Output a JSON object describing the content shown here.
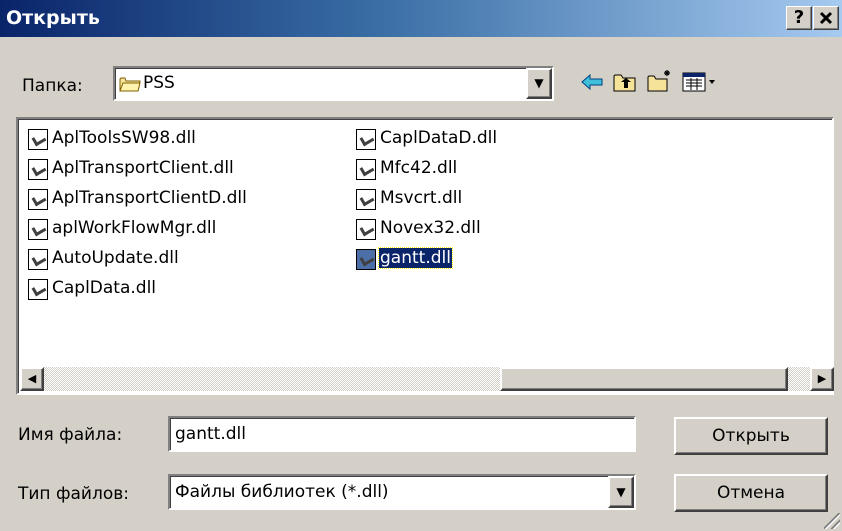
{
  "window": {
    "title": "Открыть",
    "help_label": "?",
    "close_label": "✕"
  },
  "lookin": {
    "label": "Папка:",
    "value": "PSS"
  },
  "files": [
    {
      "name": "AplToolsSW98.dll",
      "selected": false
    },
    {
      "name": "AplTransportClient.dll",
      "selected": false
    },
    {
      "name": "AplTransportClientD.dll",
      "selected": false
    },
    {
      "name": "aplWorkFlowMgr.dll",
      "selected": false
    },
    {
      "name": "AutoUpdate.dll",
      "selected": false
    },
    {
      "name": "CaplData.dll",
      "selected": false
    },
    {
      "name": "CaplDataD.dll",
      "selected": false
    },
    {
      "name": "Mfc42.dll",
      "selected": false
    },
    {
      "name": "Msvcrt.dll",
      "selected": false
    },
    {
      "name": "Novex32.dll",
      "selected": false
    },
    {
      "name": "gantt.dll",
      "selected": true
    }
  ],
  "filename": {
    "label": "Имя файла:",
    "value": "gantt.dll"
  },
  "filetype": {
    "label": "Тип файлов:",
    "value": "Файлы библиотек (*.dll)"
  },
  "buttons": {
    "open": "Открыть",
    "cancel": "Отмена"
  },
  "colors": {
    "title_start": "#0a246a",
    "title_end": "#a6caf0",
    "face": "#d4d0c8",
    "selection": "#0a246a"
  },
  "icons": {
    "folder": "folder-icon",
    "back": "back-arrow-icon",
    "up": "up-folder-icon",
    "new_folder": "new-folder-icon",
    "view_menu": "view-menu-icon",
    "file": "dll-file-icon"
  }
}
